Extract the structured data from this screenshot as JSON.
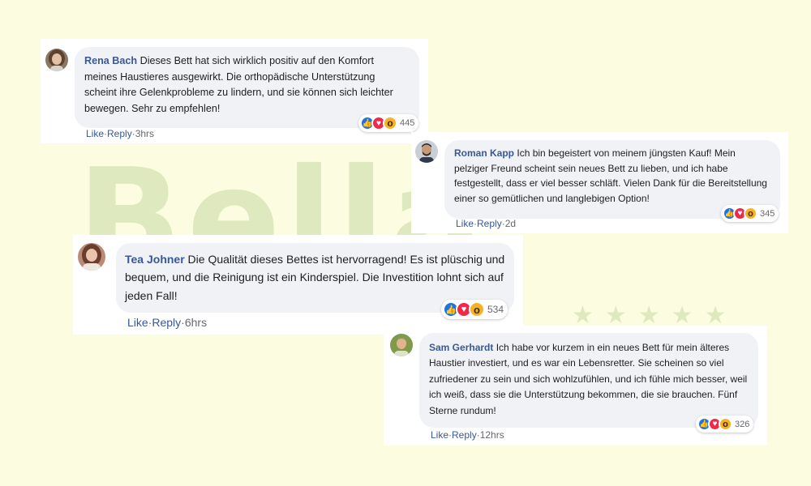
{
  "background": {
    "color": "#fcfde0",
    "logo_color": "#dfe9bf"
  },
  "colors": {
    "name": "#385898",
    "bubble": "#f0f2f5",
    "like": "#1b74e4",
    "love": "#f0284a",
    "wow": "#f7b125"
  },
  "comments": [
    {
      "author": "Rena Bach",
      "text": "Dieses Bett hat sich wirklich positiv auf den Komfort meines Haustieres ausgewirkt. Die orthopädische Unterstützung scheint ihre Gelenkprobleme zu lindern, und sie können sich leichter bewegen. Sehr zu empfehlen!",
      "reactions": "445",
      "like": "Like",
      "sep1": "·",
      "reply": "Reply",
      "sep2": "·",
      "time": "3hrs",
      "reaction_icons": [
        "like-icon",
        "love-icon",
        "wow-icon"
      ]
    },
    {
      "author": "Roman Kapp",
      "text": "Ich bin begeistert von meinem jüngsten Kauf! Mein pelziger Freund scheint sein neues Bett zu lieben, und ich habe festgestellt, dass er viel besser schläft. Vielen Dank für die Bereitstellung einer so gemütlichen und langlebigen Option!",
      "reactions": "345",
      "like": "Like",
      "sep1": "·",
      "reply": "Reply",
      "sep2": "·",
      "time": "2d",
      "reaction_icons": [
        "like-icon",
        "love-icon",
        "wow-icon"
      ]
    },
    {
      "author": "Tea Johner",
      "text": "Die Qualität dieses Bettes ist hervorragend! Es ist plüschig und bequem, und die Reinigung ist ein Kinderspiel. Die Investition lohnt sich auf jeden Fall!",
      "reactions": "534",
      "like": "Like",
      "sep1": "·",
      "reply": "Reply",
      "sep2": "·",
      "time": "6hrs",
      "reaction_icons": [
        "like-icon",
        "love-icon",
        "wow-icon"
      ]
    },
    {
      "author": "Sam Gerhardt",
      "text": "Ich habe vor kurzem in ein neues Bett für mein älteres Haustier investiert, und es war ein Lebensretter. Sie scheinen so viel zufriedener zu sein und sich wohlzufühlen, und ich fühle mich besser, weil ich weiß, dass sie die Unterstützung bekommen, die sie brauchen. Fünf Sterne rundum!",
      "reactions": "326",
      "like": "Like",
      "sep1": "·",
      "reply": "Reply",
      "sep2": "·",
      "time": "12hrs",
      "reaction_icons": [
        "like-icon",
        "love-icon",
        "wow-icon"
      ]
    }
  ]
}
